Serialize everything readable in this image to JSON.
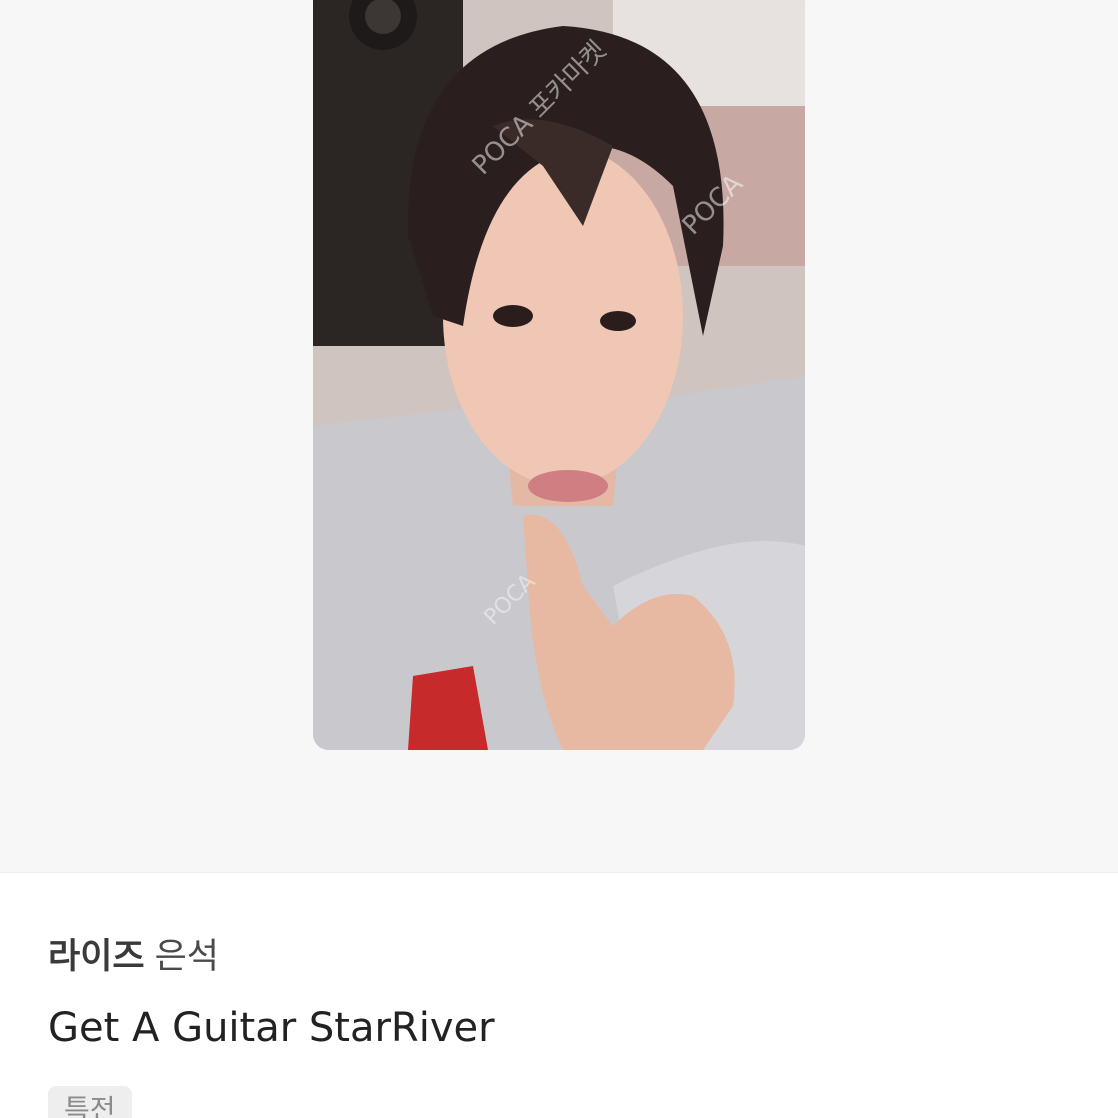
{
  "product": {
    "group": "라이즈",
    "member": "은석",
    "title": "Get A Guitar StarRiver",
    "tag": "특전"
  },
  "photo": {
    "watermark": "POCA 포카마켓"
  },
  "colors": {
    "image_background": "#f7f7f7",
    "tag_background": "#eeeeee",
    "text_primary": "#222222"
  }
}
